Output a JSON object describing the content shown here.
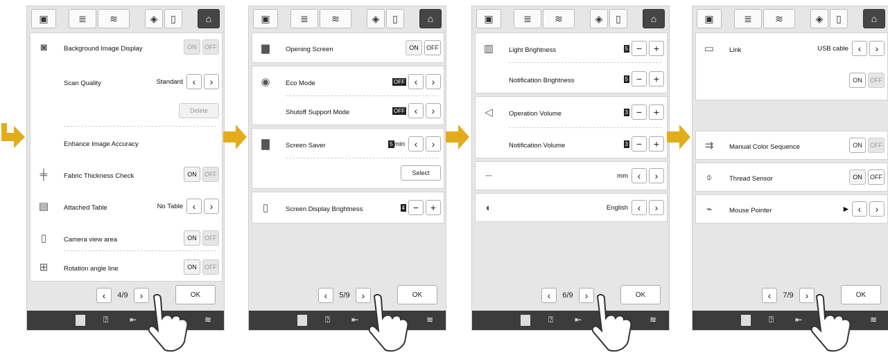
{
  "colors": {
    "accent": "#e2ac1b",
    "home_tab": "#454545",
    "status_bar": "#3c3c3c"
  },
  "tabs": [
    {
      "icon": "embroidery-icon",
      "glyph": "▣"
    },
    {
      "icon": "sewing-machine-icon",
      "glyph": "≣"
    },
    {
      "icon": "wifi-icon",
      "glyph": "≋"
    },
    {
      "icon": "sensor-icon",
      "glyph": "◈"
    },
    {
      "icon": "frame-icon",
      "glyph": "▯"
    },
    {
      "icon": "home-icon",
      "glyph": "⌂"
    }
  ],
  "status_icons": [
    "doc-icon",
    "help-icon",
    "hoop-icon",
    "wifi-icon"
  ],
  "ok_label": "OK",
  "panels": [
    {
      "page": "4",
      "total": "9",
      "rows": [
        {
          "label": "Background Image Display",
          "on": "ON",
          "off": "OFF"
        },
        {
          "label": "Scan Quality",
          "value": "Standard"
        },
        {
          "delete": "Delete"
        },
        {
          "label": "Enhance Image Accuracy"
        },
        {
          "label": "Fabric Thickness Check",
          "on": "ON",
          "off": "OFF"
        },
        {
          "label": "Attached Table",
          "value": "No Table"
        },
        {
          "label": "Camera view area",
          "on": "ON",
          "off": "OFF"
        },
        {
          "label": "Rotation angle line",
          "on": "ON",
          "off": "OFF"
        }
      ]
    },
    {
      "page": "5",
      "total": "9",
      "rows": [
        {
          "label": "Opening Screen",
          "on": "ON",
          "off": "OFF"
        },
        {
          "label": "Eco Mode",
          "value": "OFF"
        },
        {
          "label": "Shutoff Support Mode",
          "value": "OFF"
        },
        {
          "label": "Screen Saver",
          "value": "5",
          "unit": "min"
        },
        {
          "select": "Select"
        },
        {
          "label": "Screen Display Brightness",
          "value": "4"
        }
      ]
    },
    {
      "page": "6",
      "total": "9",
      "rows": [
        {
          "label": "Light Brightness",
          "value": "5"
        },
        {
          "label": "Notification Brightness",
          "value": "5"
        },
        {
          "label": "Operation Volume",
          "value": "3"
        },
        {
          "label": "Notification Volume",
          "value": "3"
        },
        {
          "value": "mm"
        },
        {
          "value": "English"
        }
      ]
    },
    {
      "page": "7",
      "total": "9",
      "rows": [
        {
          "label": "Link",
          "value": "USB cable"
        },
        {
          "on": "ON",
          "off": "OFF"
        },
        {
          "label": "Manual Color Sequence",
          "on": "ON",
          "off": "OFF"
        },
        {
          "label": "Thread Sensor",
          "on": "ON",
          "off": "OFF"
        },
        {
          "label": "Mouse Pointer",
          "value": "▶"
        }
      ]
    }
  ]
}
